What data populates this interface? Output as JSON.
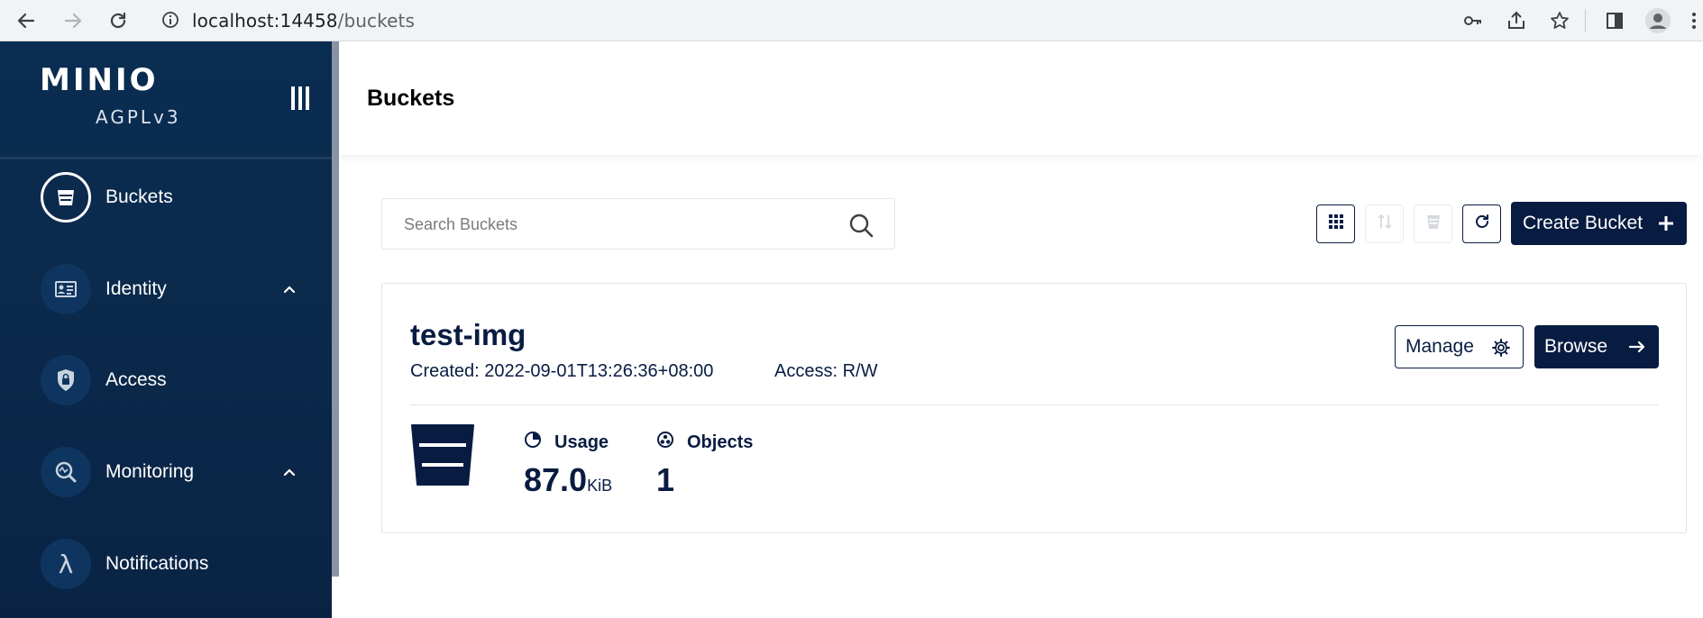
{
  "browser": {
    "url_host": "localhost:14458",
    "url_path": "/buckets"
  },
  "sidebar": {
    "brand": "MINIO",
    "license": "AGPLv3",
    "items": [
      {
        "label": "Buckets",
        "icon": "bucket-icon",
        "active": true,
        "expandable": false
      },
      {
        "label": "Identity",
        "icon": "id-card-icon",
        "active": false,
        "expandable": true
      },
      {
        "label": "Access",
        "icon": "lock-shield-icon",
        "active": false,
        "expandable": false
      },
      {
        "label": "Monitoring",
        "icon": "monitor-search-icon",
        "active": false,
        "expandable": true
      },
      {
        "label": "Notifications",
        "icon": "lambda-icon",
        "active": false,
        "expandable": false
      }
    ]
  },
  "header": {
    "title": "Buckets"
  },
  "search": {
    "placeholder": "Search Buckets",
    "value": ""
  },
  "toolbar": {
    "create_label": "Create Bucket"
  },
  "buckets": [
    {
      "name": "test-img",
      "created": "Created: 2022-09-01T13:26:36+08:00",
      "access": "Access: R/W",
      "manage_label": "Manage",
      "browse_label": "Browse",
      "usage_label": "Usage",
      "usage_value": "87.0",
      "usage_unit": "KiB",
      "objects_label": "Objects",
      "objects_value": "1"
    }
  ],
  "colors": {
    "primary": "#081c42",
    "sidebar": "#0a2d52"
  }
}
